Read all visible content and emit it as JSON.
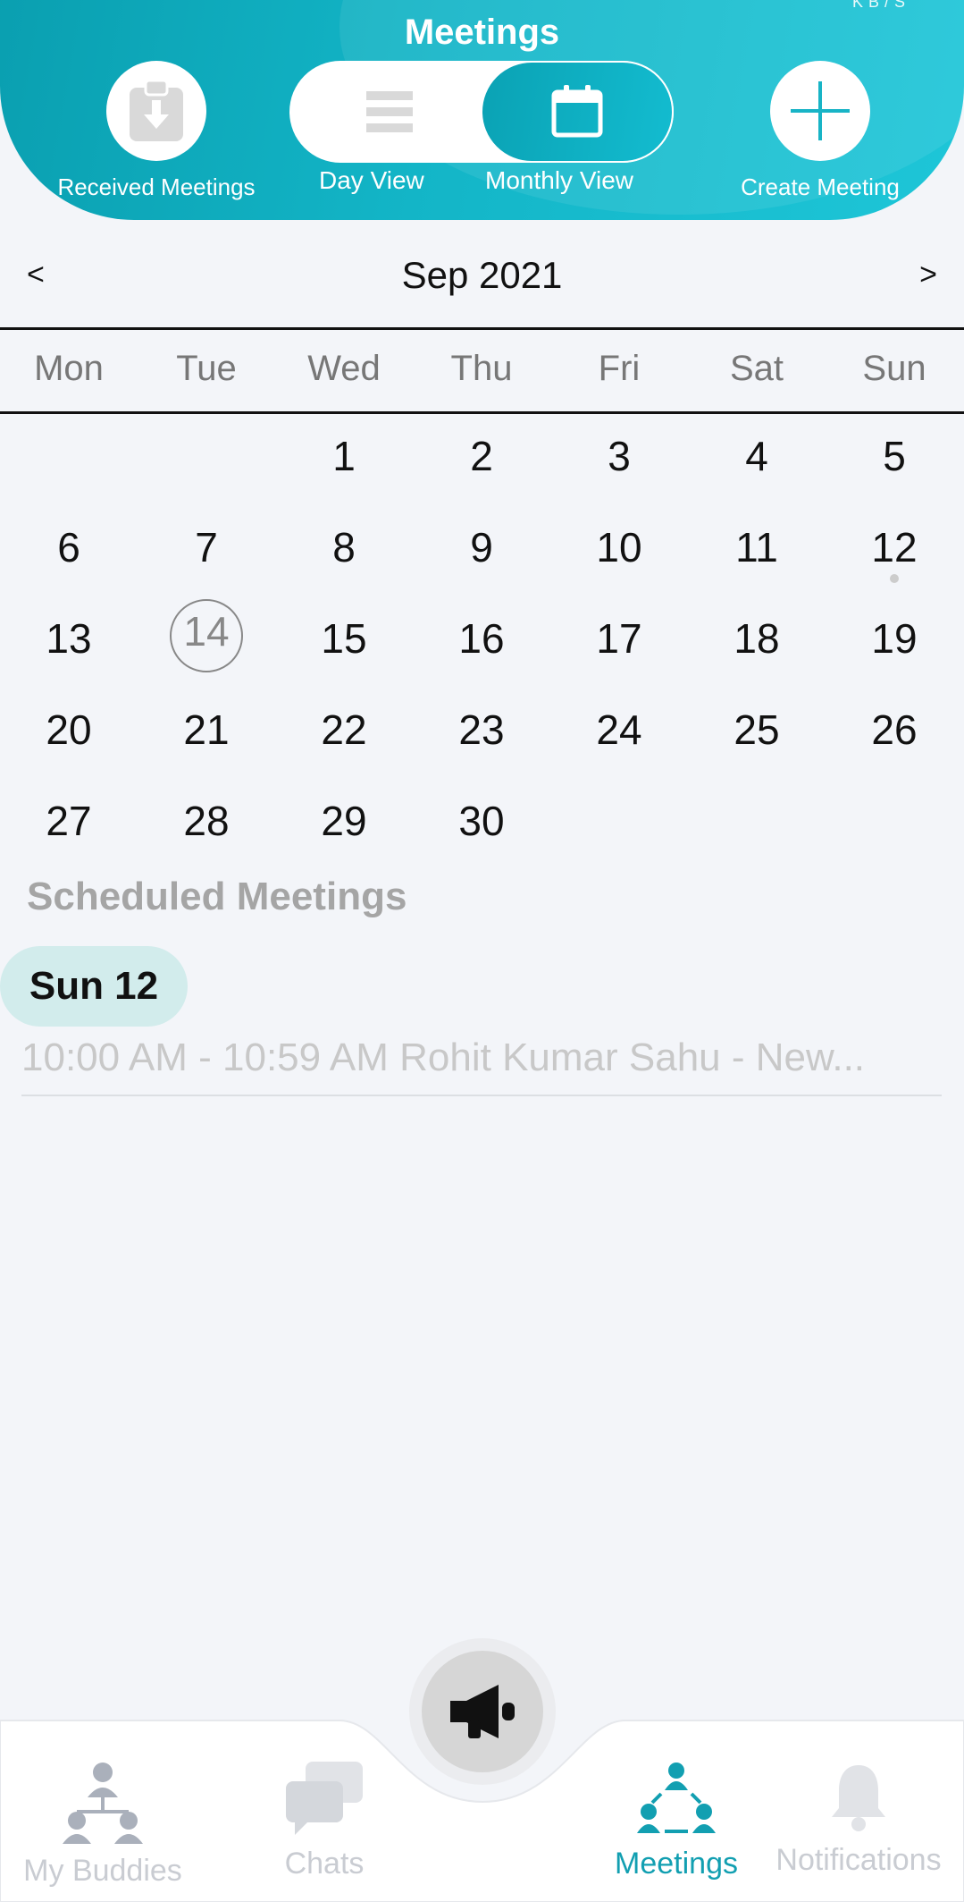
{
  "header": {
    "title": "Meetings",
    "status_text": "KB/S",
    "received_label": "Received Meetings",
    "day_view_label": "Day View",
    "monthly_view_label": "Monthly View",
    "create_label": "Create Meeting",
    "active_view": "Monthly View",
    "accent_color": "#13b5c7"
  },
  "calendar": {
    "prev": "<",
    "next": ">",
    "month_title": "Sep 2021",
    "weekdays": [
      "Mon",
      "Tue",
      "Wed",
      "Thu",
      "Fri",
      "Sat",
      "Sun"
    ],
    "weeks": [
      [
        "",
        "",
        "1",
        "2",
        "3",
        "4",
        "5"
      ],
      [
        "6",
        "7",
        "8",
        "9",
        "10",
        "11",
        "12"
      ],
      [
        "13",
        "14",
        "15",
        "16",
        "17",
        "18",
        "19"
      ],
      [
        "20",
        "21",
        "22",
        "23",
        "24",
        "25",
        "26"
      ],
      [
        "27",
        "28",
        "29",
        "30",
        "",
        "",
        ""
      ]
    ],
    "today": "14",
    "marked_days": [
      "12"
    ]
  },
  "scheduled": {
    "title": "Scheduled Meetings",
    "date_label": "Sun 12",
    "meetings": [
      {
        "text": "10:00 AM - 10:59 AM Rohit Kumar Sahu - New..."
      }
    ]
  },
  "bottom_nav": {
    "items": [
      {
        "label": "My Buddies",
        "icon": "buddies-icon",
        "active": false
      },
      {
        "label": "Chats",
        "icon": "chats-icon",
        "active": false
      },
      {
        "label": "Meetings",
        "icon": "meetings-icon",
        "active": true
      },
      {
        "label": "Notifications",
        "icon": "bell-icon",
        "active": false
      }
    ],
    "fab_icon": "megaphone-icon",
    "active_color": "#129fb1"
  }
}
